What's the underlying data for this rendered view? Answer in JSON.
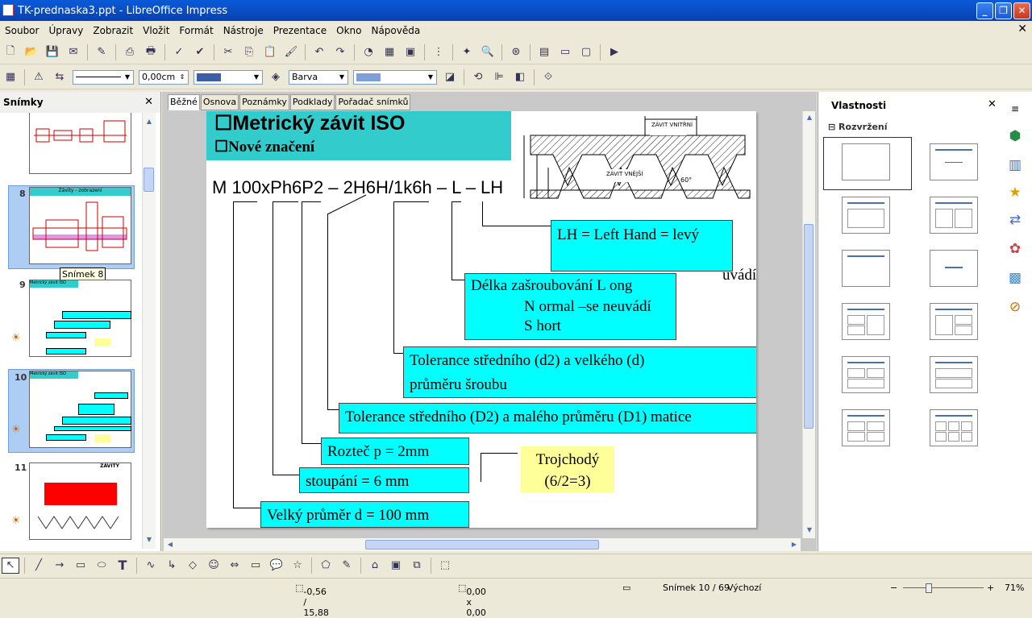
{
  "window": {
    "title": "TK-prednaska3.ppt - LibreOffice Impress"
  },
  "menu": [
    "Soubor",
    "Úpravy",
    "Zobrazit",
    "Vložit",
    "Formát",
    "Nástroje",
    "Prezentace",
    "Okno",
    "Nápověda"
  ],
  "toolbar2": {
    "line_width": "0,00cm",
    "area_style": "Barva"
  },
  "slides_panel": {
    "title": "Snímky",
    "tooltip": "Snímek 8",
    "thumbs": [
      {
        "num": "8",
        "title": "Závity - zobrazení"
      },
      {
        "num": "9",
        "title": "Metrický závit ISO"
      },
      {
        "num": "10",
        "title": "Metrický závit ISO"
      },
      {
        "num": "11",
        "title": "ZÁVITY"
      }
    ]
  },
  "view_tabs": [
    "Běžné",
    "Osnova",
    "Poznámky",
    "Podklady",
    "Pořadač snímků"
  ],
  "slide": {
    "title": "Metrický závit ISO",
    "subtitle": "Nové značení",
    "designation": "M 100xPh6P2 – 2H6H/1k6h – L – LH",
    "fig_label_vnitrni": "ZÁVIT VNITŘNÍ",
    "fig_label_vnejsi": "ZÁVIT VNĚJŠÍ",
    "fig_angle": "60°",
    "box_lh": "LH = Left Hand = levý",
    "hidden_text": "uvádí)",
    "box_delka_1": "Délka zašroubování L ong",
    "box_delka_2": "N ormal –se neuvádí",
    "box_delka_3": "S hort",
    "box_tol_sroub_1": "Tolerance středního (d2) a velkého (d)",
    "box_tol_sroub_2": "průměru šroubu",
    "box_tol_matice": "Tolerance středního (D2) a malého průměru (D1) matice",
    "box_roztec": "Rozteč p = 2mm",
    "box_stoupani": "stoupání = 6 mm",
    "box_prumer": "Velký průměr d = 100 mm",
    "box_trojchody_1": "Trojchodý",
    "box_trojchody_2": "(6/2=3)"
  },
  "properties": {
    "title": "Vlastnosti",
    "section": "Rozvržení"
  },
  "status": {
    "position": "-0,56 / 15,88",
    "size": "0,00 x 0,00",
    "slide": "Snímek 10 / 69",
    "master": "Výchozí",
    "zoom": "71%"
  },
  "colors": {
    "titlebar": "#0a5ad8",
    "teal": "#33cccc",
    "cyan": "#00ffff",
    "yellow": "#ffff99"
  }
}
